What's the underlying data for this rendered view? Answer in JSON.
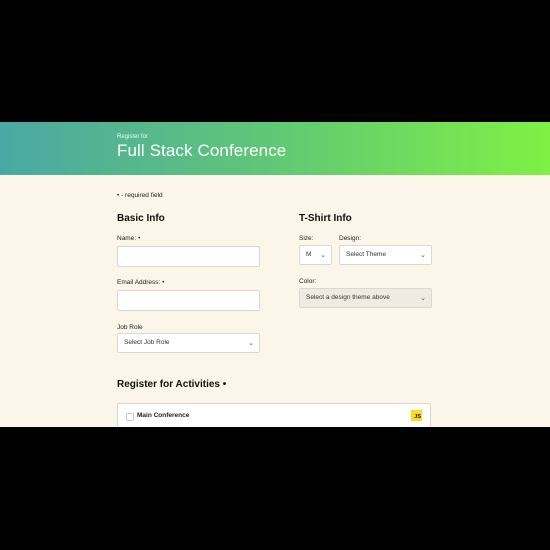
{
  "header": {
    "subtitle": "Register for",
    "title": "Full Stack Conference"
  },
  "required_note": "• - required field",
  "basic_info": {
    "heading": "Basic Info",
    "name_label": "Name: •",
    "email_label": "Email Address: •",
    "job_role_label": "Job Role",
    "job_role_selected": "Select Job Role"
  },
  "tshirt_info": {
    "heading": "T-Shirt Info",
    "size_label": "Size:",
    "size_selected": "M",
    "design_label": "Design:",
    "design_selected": "Select Theme",
    "color_label": "Color:",
    "color_selected": "Select a design theme above"
  },
  "activities": {
    "heading": "Register for Activities •",
    "items": [
      {
        "label": "Main Conference",
        "badge": "JS",
        "checked": false
      }
    ]
  },
  "colors": {
    "banner_start": "#4aa8a4",
    "banner_end": "#7ff044",
    "page_background": "#fcf6ea",
    "js_badge": "#f7df1e"
  }
}
